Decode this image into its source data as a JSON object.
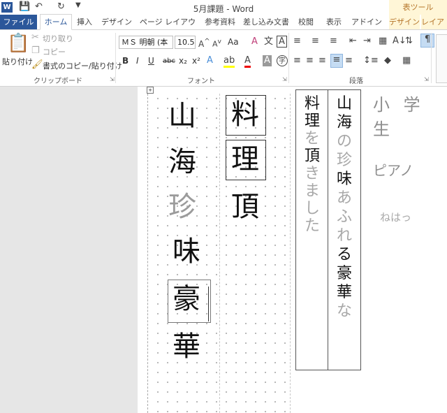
{
  "titlebar": {
    "app_icon": "W",
    "document_title": "5月課題 - Word",
    "context_title": "表ツール",
    "qat_icons": [
      "save-icon",
      "undo-icon",
      "redo-icon"
    ]
  },
  "tabs": [
    {
      "label": "ファイル"
    },
    {
      "label": "ホーム"
    },
    {
      "label": "挿入"
    },
    {
      "label": "デザイン"
    },
    {
      "label": "ページ レイアウト"
    },
    {
      "label": "参考資料"
    },
    {
      "label": "差し込み文書"
    },
    {
      "label": "校閲"
    },
    {
      "label": "表示"
    },
    {
      "label": "アドイン"
    },
    {
      "label": "デザイン"
    },
    {
      "label": "レイア"
    }
  ],
  "ribbon": {
    "clipboard": {
      "paste": "貼り付け",
      "cut": "切り取り",
      "copy": "コピー",
      "format_painter": "書式のコピー/貼り付け",
      "group_label": "クリップボード"
    },
    "font": {
      "font_name": "ＭＳ 明朝 (本",
      "font_size": "10.5",
      "group_label": "フォント",
      "case_label": "Aa",
      "bold": "B",
      "italic": "I",
      "underline": "U",
      "strike": "abc",
      "subscript": "x₂",
      "superscript": "x²"
    },
    "paragraph": {
      "group_label": "段落"
    }
  },
  "document": {
    "grid_left": {
      "col1": [
        "山",
        "海",
        "珍",
        "味",
        "豪",
        "華"
      ],
      "col1_faint": [
        false,
        false,
        true,
        false,
        false,
        false
      ],
      "col2": [
        "料",
        "理",
        "頂"
      ]
    },
    "table_col_left": [
      "料",
      "理",
      "を",
      "頂",
      "き",
      "ま",
      "し",
      "た"
    ],
    "table_col_left_faint": [
      false,
      false,
      true,
      false,
      true,
      true,
      true,
      true
    ],
    "table_col_right": [
      "山",
      "海",
      "の",
      "珍",
      "味",
      "あ",
      "ふ",
      "れ",
      "る",
      "豪",
      "華",
      "な"
    ],
    "table_col_right_faint": [
      false,
      false,
      true,
      true,
      false,
      true,
      true,
      true,
      false,
      false,
      false,
      true
    ],
    "margin_notes": [
      "小 学 生",
      "ピアノ",
      "ねはっ"
    ]
  }
}
